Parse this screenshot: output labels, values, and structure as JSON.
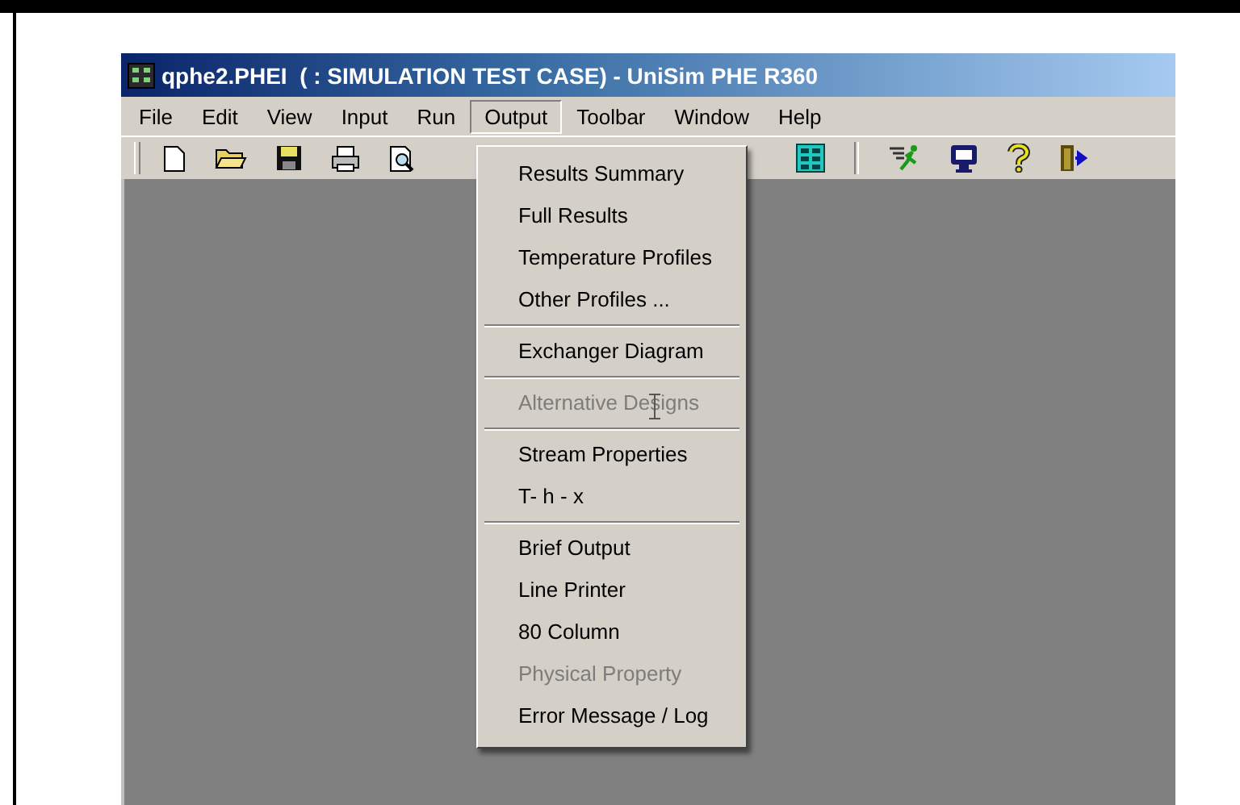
{
  "window": {
    "title": "qphe2.PHEI  ( : SIMULATION TEST CASE) - UniSim PHE R360"
  },
  "menu_bar": [
    {
      "label": "File",
      "selected": false
    },
    {
      "label": "Edit",
      "selected": false
    },
    {
      "label": "View",
      "selected": false
    },
    {
      "label": "Input",
      "selected": false
    },
    {
      "label": "Run",
      "selected": false
    },
    {
      "label": "Output",
      "selected": true
    },
    {
      "label": "Toolbar",
      "selected": false
    },
    {
      "label": "Window",
      "selected": false
    },
    {
      "label": "Help",
      "selected": false
    }
  ],
  "output_menu": {
    "items": [
      {
        "kind": "item",
        "label": "Results Summary",
        "disabled": false
      },
      {
        "kind": "item",
        "label": "Full Results",
        "disabled": false
      },
      {
        "kind": "item",
        "label": "Temperature Profiles",
        "disabled": false
      },
      {
        "kind": "item",
        "label": "Other Profiles ...",
        "disabled": false
      },
      {
        "kind": "separator"
      },
      {
        "kind": "item",
        "label": "Exchanger Diagram",
        "disabled": false
      },
      {
        "kind": "separator"
      },
      {
        "kind": "item",
        "label": "Alternative Designs",
        "disabled": true
      },
      {
        "kind": "separator"
      },
      {
        "kind": "item",
        "label": "Stream Properties",
        "disabled": false
      },
      {
        "kind": "item",
        "label": "T- h - x",
        "disabled": false
      },
      {
        "kind": "separator"
      },
      {
        "kind": "item",
        "label": "Brief Output",
        "disabled": false
      },
      {
        "kind": "item",
        "label": "Line Printer",
        "disabled": false
      },
      {
        "kind": "item",
        "label": "80 Column",
        "disabled": false
      },
      {
        "kind": "item",
        "label": "Physical Property",
        "disabled": true
      },
      {
        "kind": "item",
        "label": "Error Message / Log",
        "disabled": false
      }
    ]
  }
}
